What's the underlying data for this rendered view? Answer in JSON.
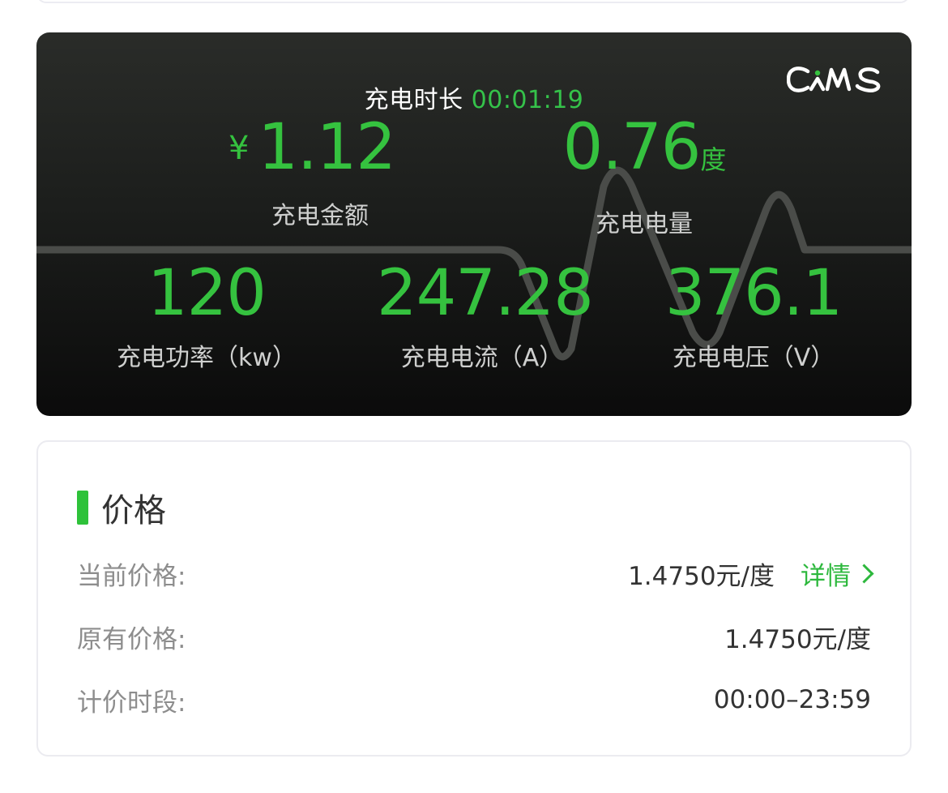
{
  "session": {
    "duration_label": "充电时长",
    "duration_value": "00:01:19",
    "logo_text": "CAMS"
  },
  "metrics": {
    "amount": {
      "currency": "¥",
      "value": "1.12",
      "label": "充电金额"
    },
    "energy": {
      "value": "0.76",
      "unit": "度",
      "label": "充电电量"
    },
    "power": {
      "value": "120",
      "label": "充电功率（kw）"
    },
    "current": {
      "value": "247.28",
      "label": "充电电流（A）"
    },
    "voltage": {
      "value": "376.1",
      "label": "充电电压（V）"
    }
  },
  "colors": {
    "accent": "#35c23f",
    "panel_dark": "#1c1e1c"
  },
  "price": {
    "title": "价格",
    "rows": [
      {
        "key": "当前价格:",
        "value": "1.4750元/度",
        "link": "详情"
      },
      {
        "key": "原有价格:",
        "value": "1.4750元/度"
      },
      {
        "key": "计价时段:",
        "value": "00:00–23:59"
      }
    ]
  }
}
